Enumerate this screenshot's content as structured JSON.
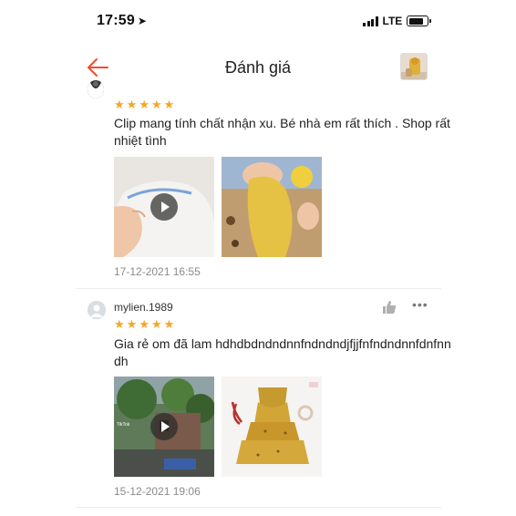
{
  "status_bar": {
    "time": "17:59",
    "network": "LTE",
    "battery_level": 0.8,
    "icons": [
      "location-arrow-icon",
      "signal-icon",
      "battery-icon"
    ]
  },
  "nav": {
    "title": "Đánh giá",
    "back_icon": "arrow-left-icon",
    "accent_color": "#ee4d2d"
  },
  "reviews": [
    {
      "rating": 5,
      "text": "Clip mang tính chất nhận xu. Bé nhà em rất thích . Shop rất nhiệt tình",
      "media": [
        {
          "kind": "video",
          "icon": "play-icon"
        },
        {
          "kind": "image"
        }
      ],
      "date": "17-12-2021 16:55"
    },
    {
      "username": "mylien.1989",
      "rating": 5,
      "text": "Gia rẻ om đã lam hdhdbdndndnnfndndndjfjjfnfndndnnfdnfnndh",
      "media": [
        {
          "kind": "video",
          "icon": "play-icon",
          "watermark": "TikTok"
        },
        {
          "kind": "image"
        }
      ],
      "date": "15-12-2021 19:06",
      "actions": {
        "like_icon": "thumbs-up-icon",
        "more_label": "•••"
      }
    }
  ],
  "colors": {
    "star": "#f5a623",
    "timestamp": "#8a8a8a",
    "divider": "#ececec"
  }
}
